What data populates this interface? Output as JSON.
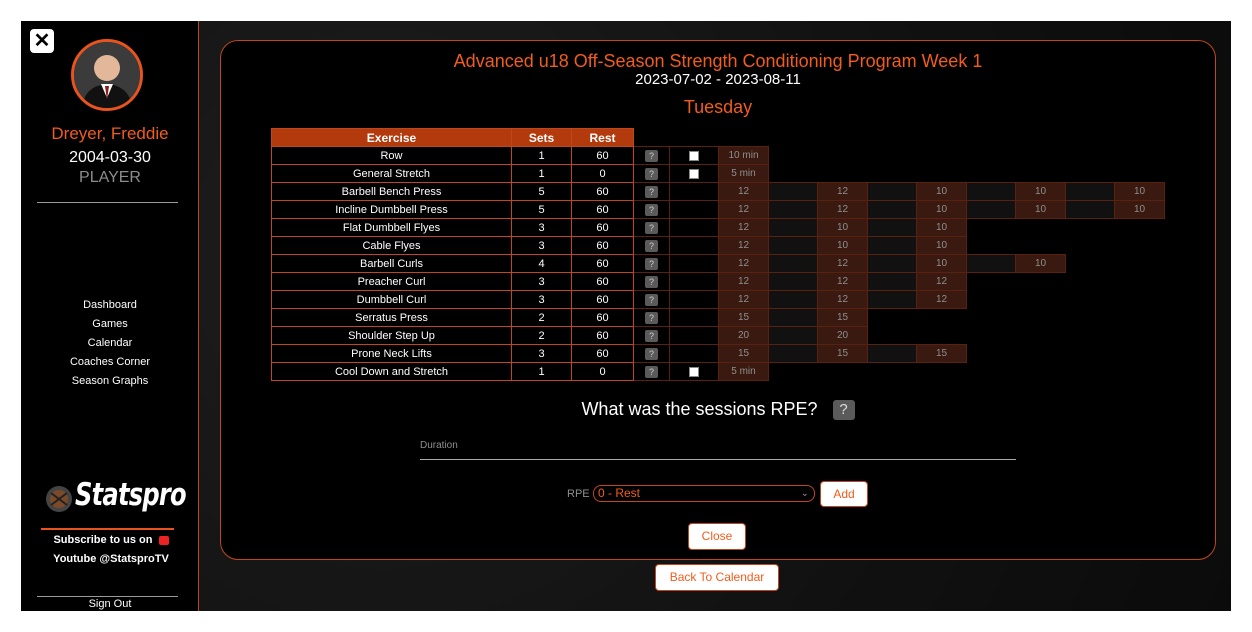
{
  "sidebar": {
    "close_label": "✕",
    "player_name": "Dreyer, Freddie",
    "player_dob": "2004-03-30",
    "player_role": "PLAYER",
    "nav": [
      "Dashboard",
      "Games",
      "Calendar",
      "Coaches Corner",
      "Season Graphs"
    ],
    "logo_text": "Statspro",
    "promo_line1": "Subscribe to us on",
    "promo_line2": "Youtube @StatsproTV",
    "sign_out": "Sign Out"
  },
  "program": {
    "title": "Advanced u18 Off-Season Strength Conditioning Program Week 1",
    "dates": "2023-07-02 - 2023-08-11",
    "day": "Tuesday"
  },
  "table": {
    "headers": {
      "exercise": "Exercise",
      "sets": "Sets",
      "rest": "Rest"
    },
    "help_symbol": "?",
    "rows": [
      {
        "exercise": "Row",
        "sets": "1",
        "rest": "60",
        "checkbox": true,
        "values": [
          "10 min"
        ]
      },
      {
        "exercise": "General Stretch",
        "sets": "1",
        "rest": "0",
        "checkbox": true,
        "values": [
          "5 min"
        ]
      },
      {
        "exercise": "Barbell Bench Press",
        "sets": "5",
        "rest": "60",
        "checkbox": false,
        "values": [
          "12",
          "12",
          "10",
          "10",
          "10"
        ]
      },
      {
        "exercise": "Incline Dumbbell Press",
        "sets": "5",
        "rest": "60",
        "checkbox": false,
        "values": [
          "12",
          "12",
          "10",
          "10",
          "10"
        ]
      },
      {
        "exercise": "Flat Dumbbell Flyes",
        "sets": "3",
        "rest": "60",
        "checkbox": false,
        "values": [
          "12",
          "10",
          "10"
        ]
      },
      {
        "exercise": "Cable Flyes",
        "sets": "3",
        "rest": "60",
        "checkbox": false,
        "values": [
          "12",
          "10",
          "10"
        ]
      },
      {
        "exercise": "Barbell Curls",
        "sets": "4",
        "rest": "60",
        "checkbox": false,
        "values": [
          "12",
          "12",
          "10",
          "10"
        ]
      },
      {
        "exercise": "Preacher Curl",
        "sets": "3",
        "rest": "60",
        "checkbox": false,
        "values": [
          "12",
          "12",
          "12"
        ]
      },
      {
        "exercise": "Dumbbell Curl",
        "sets": "3",
        "rest": "60",
        "checkbox": false,
        "values": [
          "12",
          "12",
          "12"
        ]
      },
      {
        "exercise": "Serratus Press",
        "sets": "2",
        "rest": "60",
        "checkbox": false,
        "values": [
          "15",
          "15"
        ]
      },
      {
        "exercise": "Shoulder Step Up",
        "sets": "2",
        "rest": "60",
        "checkbox": false,
        "values": [
          "20",
          "20"
        ]
      },
      {
        "exercise": "Prone Neck Lifts",
        "sets": "3",
        "rest": "60",
        "checkbox": false,
        "values": [
          "15",
          "15",
          "15"
        ]
      },
      {
        "exercise": "Cool Down and Stretch",
        "sets": "1",
        "rest": "0",
        "checkbox": true,
        "values": [
          "5 min"
        ]
      }
    ]
  },
  "rpe": {
    "question": "What was the sessions RPE?",
    "help_symbol": "?",
    "duration_label": "Duration",
    "label": "RPE",
    "selected": "0 - Rest",
    "add_label": "Add",
    "close_label": "Close",
    "back_label": "Back To Calendar"
  },
  "colors": {
    "accent": "#f25c1c",
    "border": "#c0471d",
    "header_bg": "#b23a0d",
    "background": "#121212"
  },
  "icons": [
    "close-icon",
    "help-icon",
    "chevron-down-icon",
    "youtube-icon"
  ]
}
